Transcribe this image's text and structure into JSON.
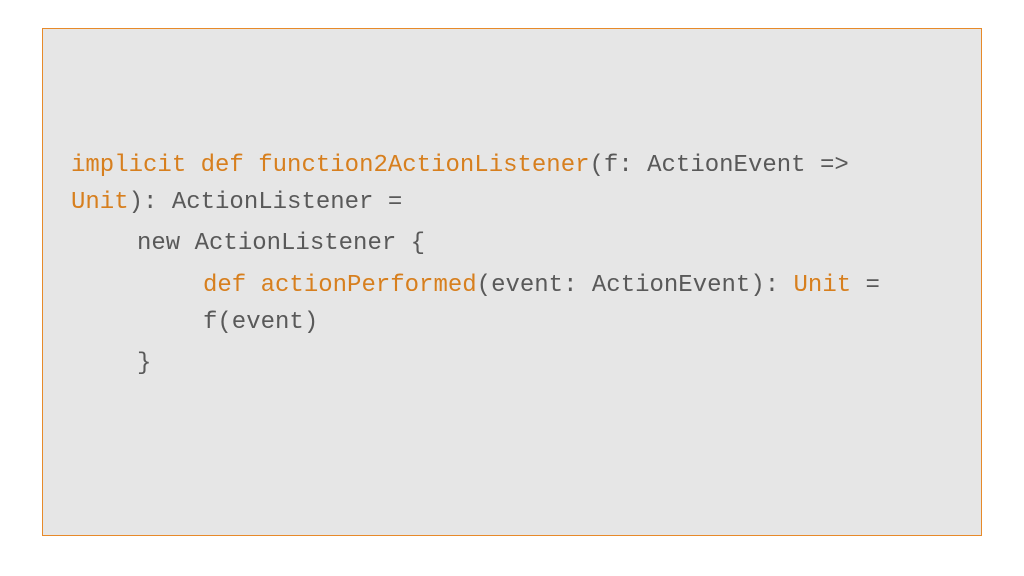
{
  "colors": {
    "page_bg": "#ffffff",
    "card_bg": "#e6e6e6",
    "card_border": "#e78a2a",
    "keyword": "#d77f1e",
    "text": "#595959"
  },
  "code": {
    "l1_kw1": "implicit",
    "l1_sp1": " ",
    "l1_kw2": "def",
    "l1_sp2": " ",
    "l1_fn": "function2ActionListener",
    "l1_rest": "(f: ActionEvent => ",
    "l2_kw": "Unit",
    "l2_rest": "): ActionListener =",
    "l3": "new ActionListener {",
    "l4_kw": "def",
    "l4_sp": " ",
    "l4_fn": "actionPerformed",
    "l4_mid": "(event: ActionEvent): ",
    "l4_kw2": "Unit",
    "l4_end": " =",
    "l5": "f(event)",
    "l6": "}"
  }
}
